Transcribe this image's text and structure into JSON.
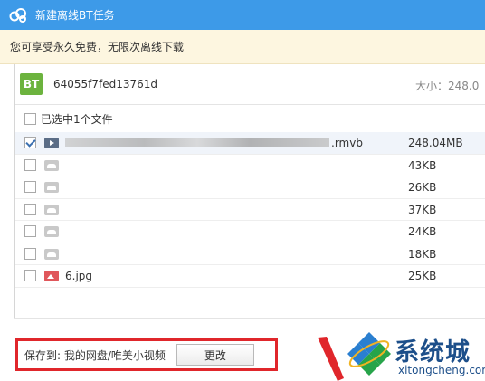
{
  "window": {
    "title": "新建离线BT任务"
  },
  "notice": {
    "text": "您可享受永久免费，无限次离线下载"
  },
  "torrent": {
    "icon_label": "BT",
    "name": "64055f7fed13761d",
    "size_label": "大小：248.0"
  },
  "select_all": {
    "label": "已选中1个文件",
    "checked": false
  },
  "files": [
    {
      "checked": true,
      "icon": "video-file-icon",
      "name": "",
      "ext": ".rmvb",
      "size": "248.04MB",
      "blurred": true
    },
    {
      "checked": false,
      "icon": "file-icon",
      "name": "",
      "ext": "",
      "size": "43KB",
      "blurred": false
    },
    {
      "checked": false,
      "icon": "file-icon",
      "name": "",
      "ext": "",
      "size": "26KB",
      "blurred": false
    },
    {
      "checked": false,
      "icon": "file-icon",
      "name": "",
      "ext": "",
      "size": "37KB",
      "blurred": false
    },
    {
      "checked": false,
      "icon": "file-icon",
      "name": "",
      "ext": "",
      "size": "24KB",
      "blurred": false
    },
    {
      "checked": false,
      "icon": "file-icon",
      "name": "",
      "ext": "",
      "size": "18KB",
      "blurred": false
    },
    {
      "checked": false,
      "icon": "image-file-icon",
      "name": "6.jpg",
      "ext": "",
      "size": "25KB",
      "blurred": false
    }
  ],
  "save": {
    "label": "保存到: 我的网盘/唯美小视频",
    "change_button": "更改"
  },
  "watermark": {
    "title": "系统城",
    "domain": "xitongcheng.com"
  },
  "colors": {
    "titlebar": "#3d9ae8",
    "notice_bg": "#fdf6e0",
    "bt_green": "#6cb33e",
    "highlight_red": "#e0262b",
    "watermark_blue": "#1d4f8a"
  }
}
